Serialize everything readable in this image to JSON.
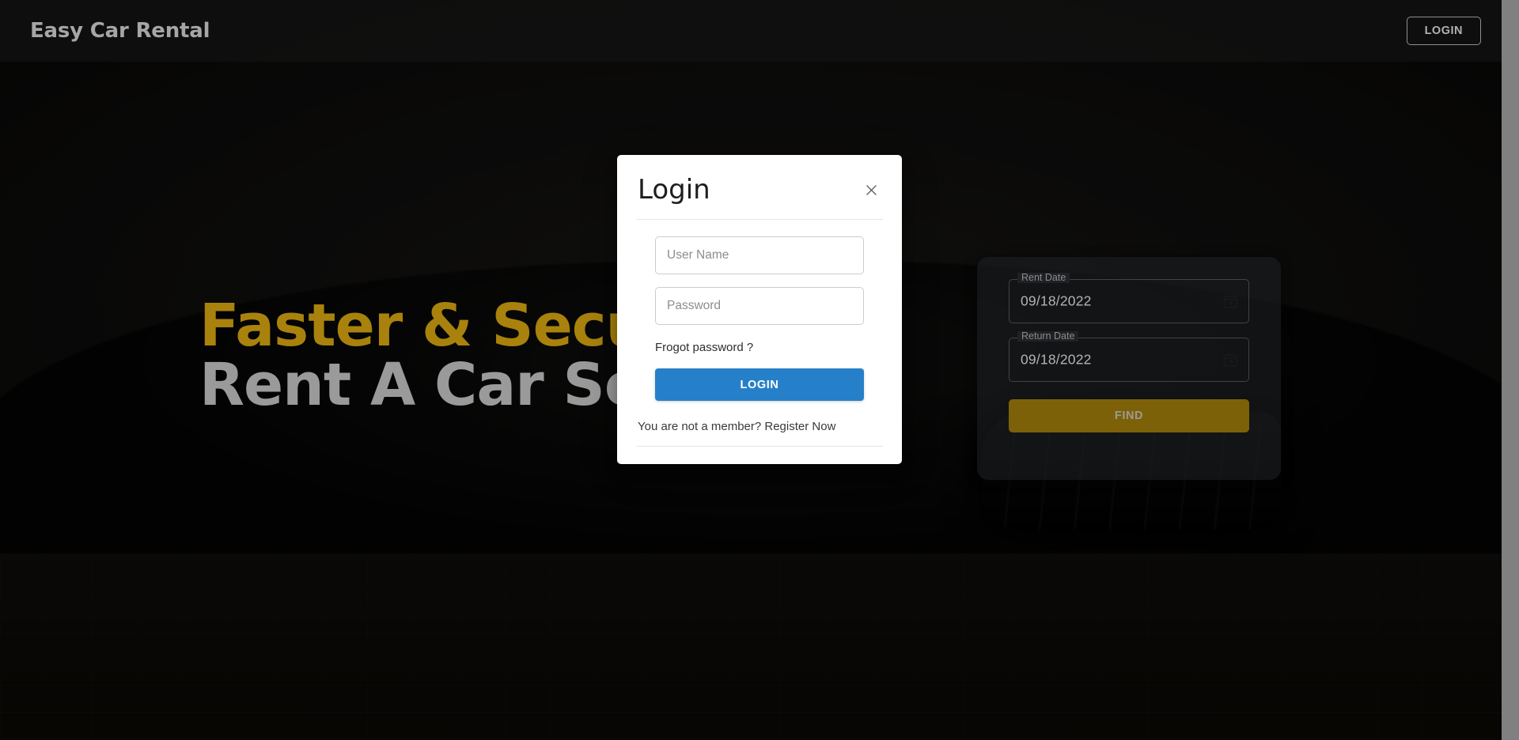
{
  "header": {
    "brand": "Easy Car Rental",
    "login_label": "LOGIN"
  },
  "hero": {
    "line1": "Faster & Secure",
    "line2": "Rent A Car Service",
    "accent_color": "#a8820c",
    "muted_color": "#9a9a9a"
  },
  "search_panel": {
    "rent_date": {
      "label": "Rent Date",
      "value": "09/18/2022"
    },
    "return_date": {
      "label": "Return Date",
      "value": "09/18/2022"
    },
    "find_label": "FIND",
    "find_color": "#7d6109"
  },
  "login_modal": {
    "title": "Login",
    "close_icon": "close-icon",
    "username": {
      "placeholder": "User Name",
      "value": ""
    },
    "password": {
      "placeholder": "Password",
      "value": ""
    },
    "forgot_label": "Frogot password ?",
    "submit_label": "LOGIN",
    "submit_color": "#2680c9",
    "register_text": "You are not a member? Register Now"
  }
}
